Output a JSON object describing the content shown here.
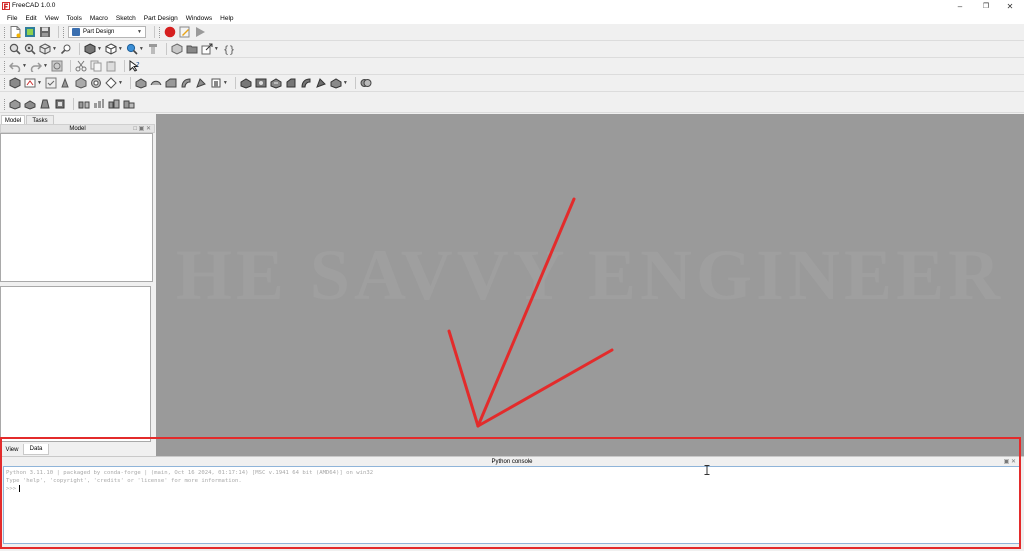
{
  "window": {
    "title": "FreeCAD 1.0.0"
  },
  "menu": [
    "File",
    "Edit",
    "View",
    "Tools",
    "Macro",
    "Sketch",
    "Part Design",
    "Windows",
    "Help"
  ],
  "workbench": {
    "selected": "Part Design"
  },
  "left_panel": {
    "top_tabs": [
      "Model",
      "Tasks"
    ],
    "header": "Model",
    "bottom_tabs": [
      "View",
      "Data"
    ]
  },
  "viewport": {
    "watermark": "HE SAVVY ENGINEER"
  },
  "console": {
    "header": "Python console",
    "lines": [
      "Python 3.11.10 | packaged by conda-forge | (main, Oct 16 2024, 01:17:14) [MSC v.1941 64 bit (AMD64)] on win32",
      "Type 'help', 'copyright', 'credits' or 'license' for more information.",
      ">>> "
    ]
  },
  "colors": {
    "annotation": "#e32b2b",
    "viewport": "#9a9a9a",
    "macro_record": "#d61f1f"
  },
  "icons": {
    "toolbar_row1": [
      "new-document-icon",
      "open-icon",
      "save-icon",
      "workbench-selector",
      "macro-record-icon",
      "macro-edit-icon",
      "macro-run-icon"
    ],
    "toolbar_row2": [
      "fit-all-icon",
      "fit-selection-icon",
      "view-box-icon",
      "zoom-icon",
      "draw-style-icon",
      "standard-views-icon",
      "measure-icon",
      "sketch-icon",
      "part-icon",
      "group-icon",
      "link-icon",
      "variable-set-icon"
    ],
    "toolbar_row3": [
      "undo-icon",
      "redo-icon",
      "refresh-icon",
      "cut-icon",
      "copy-icon",
      "paste-icon",
      "whats-this-icon"
    ]
  }
}
